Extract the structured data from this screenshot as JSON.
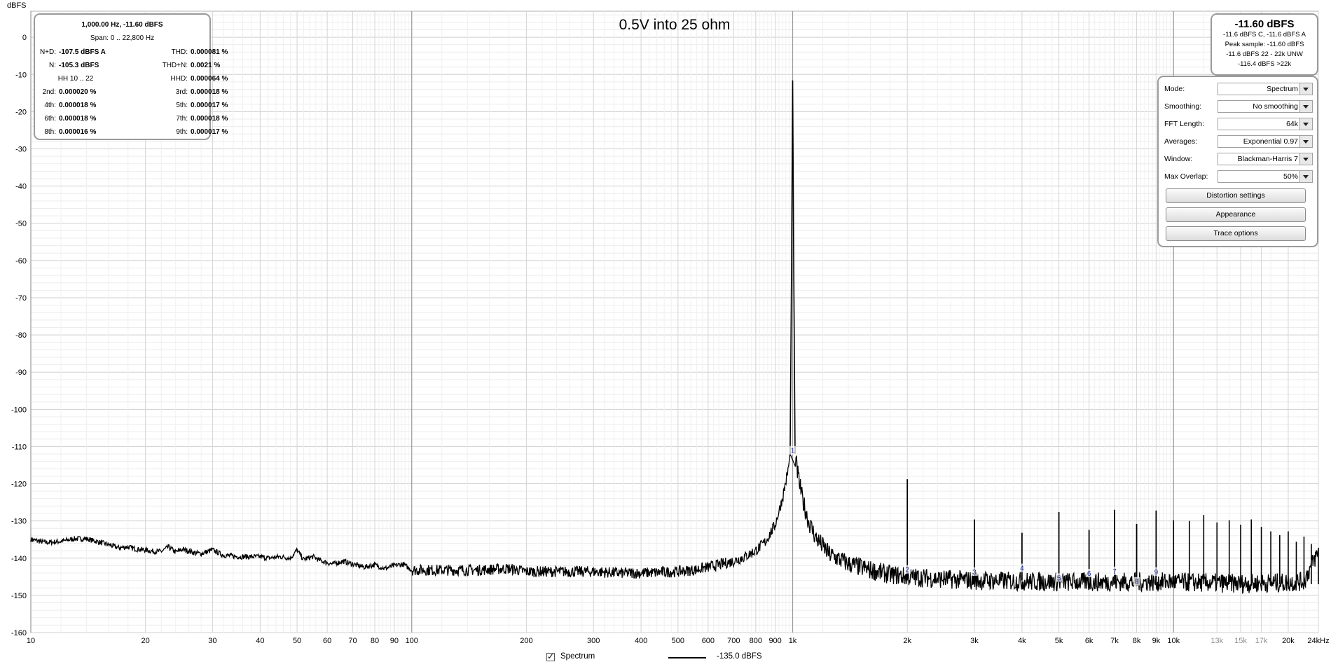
{
  "chart_data": {
    "type": "line",
    "title": "0.5V into 25 ohm",
    "ylabel": "dBFS",
    "y_ticks": [
      "0",
      "-10",
      "-20",
      "-30",
      "-40",
      "-50",
      "-60",
      "-70",
      "-80",
      "-90",
      "-100",
      "-110",
      "-120",
      "-130",
      "-140",
      "-150",
      "-160"
    ],
    "ylim": [
      -160,
      7
    ],
    "x_scale": "log",
    "xlim": [
      10,
      24000
    ],
    "x_ticks": [
      {
        "f": 10,
        "label": "10"
      },
      {
        "f": 20,
        "label": "20"
      },
      {
        "f": 30,
        "label": "30"
      },
      {
        "f": 40,
        "label": "40"
      },
      {
        "f": 50,
        "label": "50"
      },
      {
        "f": 60,
        "label": "60"
      },
      {
        "f": 70,
        "label": "70"
      },
      {
        "f": 80,
        "label": "80"
      },
      {
        "f": 90,
        "label": "90"
      },
      {
        "f": 100,
        "label": "100"
      },
      {
        "f": 200,
        "label": "200"
      },
      {
        "f": 300,
        "label": "300"
      },
      {
        "f": 400,
        "label": "400"
      },
      {
        "f": 500,
        "label": "500"
      },
      {
        "f": 600,
        "label": "600"
      },
      {
        "f": 700,
        "label": "700"
      },
      {
        "f": 800,
        "label": "800"
      },
      {
        "f": 900,
        "label": "900"
      },
      {
        "f": 1000,
        "label": "1k"
      },
      {
        "f": 2000,
        "label": "2k"
      },
      {
        "f": 3000,
        "label": "3k"
      },
      {
        "f": 4000,
        "label": "4k"
      },
      {
        "f": 5000,
        "label": "5k"
      },
      {
        "f": 6000,
        "label": "6k"
      },
      {
        "f": 7000,
        "label": "7k"
      },
      {
        "f": 8000,
        "label": "8k"
      },
      {
        "f": 9000,
        "label": "9k"
      },
      {
        "f": 10000,
        "label": "10k"
      },
      {
        "f": 13000,
        "label": "13k",
        "muted": true
      },
      {
        "f": 15000,
        "label": "15k",
        "muted": true
      },
      {
        "f": 17000,
        "label": "17k",
        "muted": true
      },
      {
        "f": 20000,
        "label": "20k"
      },
      {
        "f": 24000,
        "label": "24kHz"
      }
    ],
    "grid": true,
    "series": [
      {
        "name": "Spectrum",
        "color": "#000000",
        "points": [
          [
            10,
            -135
          ],
          [
            11,
            -135.8
          ],
          [
            12,
            -135.5
          ],
          [
            13,
            -134.8
          ],
          [
            14,
            -134.8
          ],
          [
            15,
            -135.6
          ],
          [
            16,
            -136.4
          ],
          [
            17,
            -137.2
          ],
          [
            18,
            -137
          ],
          [
            19,
            -137.6
          ],
          [
            20,
            -137.8
          ],
          [
            21,
            -138.2
          ],
          [
            22,
            -138.2
          ],
          [
            23,
            -137
          ],
          [
            24,
            -138.4
          ],
          [
            25,
            -137.6
          ],
          [
            27,
            -138.6
          ],
          [
            28,
            -138.8
          ],
          [
            30,
            -137.8
          ],
          [
            32,
            -139.2
          ],
          [
            35,
            -139.6
          ],
          [
            40,
            -139.6
          ],
          [
            42,
            -140
          ],
          [
            45,
            -139.6
          ],
          [
            48,
            -140
          ],
          [
            50,
            -137.8
          ],
          [
            52,
            -140.4
          ],
          [
            55,
            -139.6
          ],
          [
            58,
            -140.8
          ],
          [
            62,
            -141.6
          ],
          [
            66,
            -140.8
          ],
          [
            70,
            -141.6
          ],
          [
            75,
            -142.4
          ],
          [
            80,
            -141.8
          ],
          [
            85,
            -142.8
          ],
          [
            90,
            -142
          ],
          [
            95,
            -141.6
          ],
          [
            100,
            -143.2
          ],
          [
            120,
            -143.2
          ],
          [
            150,
            -143.2
          ],
          [
            180,
            -142.8
          ],
          [
            200,
            -143.6
          ],
          [
            250,
            -143.6
          ],
          [
            300,
            -143.6
          ],
          [
            350,
            -144
          ],
          [
            400,
            -144
          ],
          [
            450,
            -143.8
          ],
          [
            500,
            -143.6
          ],
          [
            550,
            -143.2
          ],
          [
            600,
            -142.4
          ],
          [
            650,
            -141.6
          ],
          [
            700,
            -140.8
          ],
          [
            750,
            -139.6
          ],
          [
            800,
            -138
          ],
          [
            850,
            -135.5
          ],
          [
            900,
            -131
          ],
          [
            940,
            -124
          ],
          [
            970,
            -117
          ],
          [
            990,
            -111
          ],
          [
            1000,
            -11.6
          ],
          [
            1010,
            -111
          ],
          [
            1030,
            -117
          ],
          [
            1060,
            -124
          ],
          [
            1100,
            -130
          ],
          [
            1150,
            -134.5
          ],
          [
            1250,
            -139
          ],
          [
            1400,
            -141.5
          ],
          [
            1600,
            -143.2
          ],
          [
            1800,
            -144.4
          ],
          [
            2000,
            -145
          ],
          [
            2500,
            -145.6
          ],
          [
            3000,
            -146
          ],
          [
            4000,
            -146.2
          ],
          [
            5000,
            -146.4
          ],
          [
            6000,
            -146.4
          ],
          [
            7000,
            -146.4
          ],
          [
            8000,
            -146.4
          ],
          [
            9000,
            -146.4
          ],
          [
            10000,
            -146.4
          ],
          [
            12000,
            -146.6
          ],
          [
            15000,
            -146.8
          ],
          [
            20000,
            -146.6
          ],
          [
            22000,
            -146.2
          ],
          [
            23500,
            -140
          ],
          [
            24000,
            -138.5
          ]
        ]
      }
    ],
    "harmonics": [
      {
        "n": "1",
        "f": 1000,
        "level": -11.6
      },
      {
        "n": "2",
        "f": 2000,
        "level": -118.8
      },
      {
        "n": "3",
        "f": 3000,
        "level": -129.6
      },
      {
        "n": "4",
        "f": 4000,
        "level": -133.2
      },
      {
        "n": "5",
        "f": 5000,
        "level": -127.6
      },
      {
        "n": "6",
        "f": 6000,
        "level": -132.4
      },
      {
        "n": "7",
        "f": 7000,
        "level": -127
      },
      {
        "n": "8",
        "f": 8000,
        "level": -130.8
      },
      {
        "n": "9",
        "f": 9000,
        "level": -127.2
      }
    ],
    "spurs": [
      {
        "f": 10000,
        "level": -129.8
      },
      {
        "f": 11000,
        "level": -130
      },
      {
        "f": 12000,
        "level": -128.4
      },
      {
        "f": 13000,
        "level": -130.4
      },
      {
        "f": 14000,
        "level": -129.8
      },
      {
        "f": 15000,
        "level": -131
      },
      {
        "f": 16000,
        "level": -129.6
      },
      {
        "f": 17000,
        "level": -131.6
      },
      {
        "f": 18000,
        "level": -132.8
      },
      {
        "f": 19000,
        "level": -133.8
      },
      {
        "f": 20000,
        "level": -132.8
      },
      {
        "f": 21000,
        "level": -135.6
      },
      {
        "f": 22000,
        "level": -134.2
      },
      {
        "f": 23000,
        "level": -136.2
      },
      {
        "f": 24000,
        "level": -137.2
      }
    ],
    "harmonic_marker_levels": [
      -111,
      -143,
      -143.6,
      -142.6,
      -145.2,
      -144,
      -143.4,
      -146.2,
      -143.6
    ]
  },
  "measurements": {
    "header": "1,000.00 Hz, -11.60 dBFS",
    "span": "Span: 0 .. 22,800 Hz",
    "rows": [
      {
        "l1": "N+D:",
        "v1": "-107.5 dBFS A",
        "l2": "THD:",
        "v2": "0.000081 %"
      },
      {
        "l1": "N:",
        "v1": "-105.3 dBFS",
        "l2": "THD+N:",
        "v2": "0.0021 %"
      },
      {
        "l1": "HH 10 .. 22",
        "v1": "",
        "l2": "HHD:",
        "v2": "0.000064 %"
      },
      {
        "l1": "2nd:",
        "v1": "0.000020 %",
        "l2": "3rd:",
        "v2": "0.000018 %"
      },
      {
        "l1": "4th:",
        "v1": "0.000018 %",
        "l2": "5th:",
        "v2": "0.000017 %"
      },
      {
        "l1": "6th:",
        "v1": "0.000018 %",
        "l2": "7th:",
        "v2": "0.000018 %"
      },
      {
        "l1": "8th:",
        "v1": "0.000016 %",
        "l2": "9th:",
        "v2": "0.000017 %"
      }
    ]
  },
  "level_meter": {
    "main": "-11.60 dBFS",
    "lines": [
      "-11.6 dBFS C, -11.6 dBFS A",
      "Peak sample: -11.60 dBFS",
      "-11.6 dBFS 22 - 22k UNW",
      "-116.4 dBFS >22k"
    ]
  },
  "settings": {
    "rows": [
      {
        "label": "Mode:",
        "value": "Spectrum"
      },
      {
        "label": "Smoothing:",
        "value": "No  smoothing"
      },
      {
        "label": "FFT Length:",
        "value": "64k"
      },
      {
        "label": "Averages:",
        "value": "Exponential 0.97"
      },
      {
        "label": "Window:",
        "value": "Blackman-Harris 7"
      },
      {
        "label": "Max Overlap:",
        "value": "50%"
      }
    ],
    "buttons": [
      "Distortion settings",
      "Appearance",
      "Trace options"
    ]
  },
  "legend": {
    "name": "Spectrum",
    "checked": true,
    "value": "-135.0 dBFS"
  }
}
